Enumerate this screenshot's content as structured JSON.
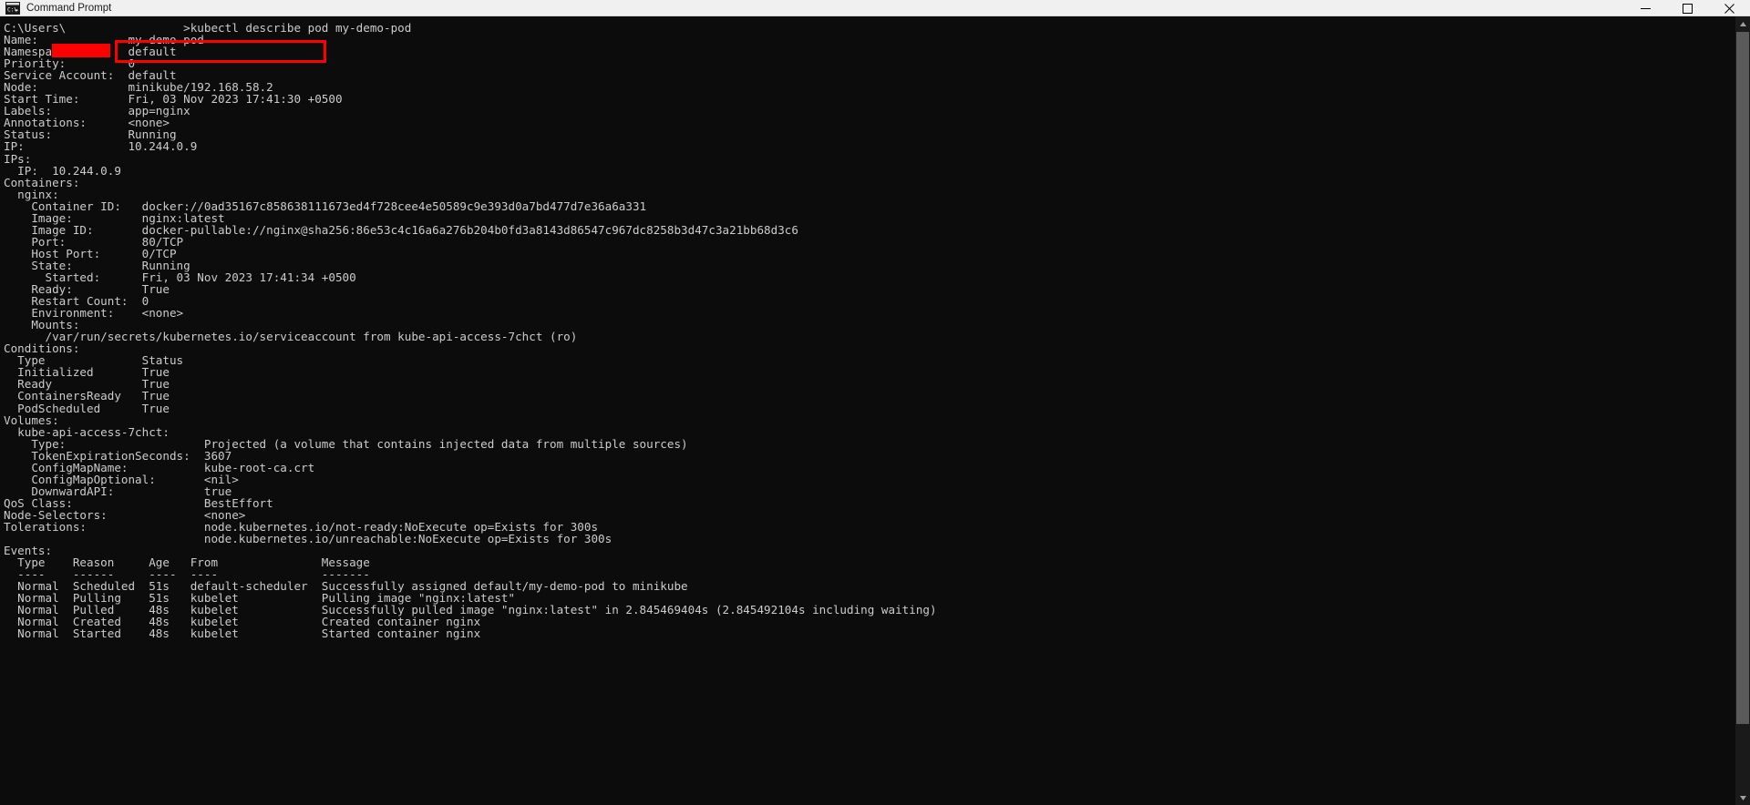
{
  "window": {
    "title": "Command Prompt",
    "icon": "console-icon",
    "controls": {
      "minimize": "minimize-icon",
      "maximize": "maximize-icon",
      "close": "close-icon"
    }
  },
  "annotations": {
    "redaction_color": "#ff0000",
    "highlight_color": "#ff0000",
    "redacted_username": true,
    "highlighted_command": "kubectl describe pod my-demo-pod"
  },
  "terminal": {
    "background": "#0c0c0c",
    "foreground": "#cccccc",
    "prompt_prefix": "C:\\Users\\",
    "prompt_suffix": ">",
    "command": "kubectl describe pod my-demo-pod",
    "lines": [
      "C:\\Users\\                 >kubectl describe pod my-demo-pod",
      "Name:             my-demo-pod",
      "Namespace:        default",
      "Priority:         0",
      "Service Account:  default",
      "Node:             minikube/192.168.58.2",
      "Start Time:       Fri, 03 Nov 2023 17:41:30 +0500",
      "Labels:           app=nginx",
      "Annotations:      <none>",
      "Status:           Running",
      "IP:               10.244.0.9",
      "IPs:",
      "  IP:  10.244.0.9",
      "Containers:",
      "  nginx:",
      "    Container ID:   docker://0ad35167c858638111673ed4f728cee4e50589c9e393d0a7bd477d7e36a6a331",
      "    Image:          nginx:latest",
      "    Image ID:       docker-pullable://nginx@sha256:86e53c4c16a6a276b204b0fd3a8143d86547c967dc8258b3d47c3a21bb68d3c6",
      "    Port:           80/TCP",
      "    Host Port:      0/TCP",
      "    State:          Running",
      "      Started:      Fri, 03 Nov 2023 17:41:34 +0500",
      "    Ready:          True",
      "    Restart Count:  0",
      "    Environment:    <none>",
      "    Mounts:",
      "      /var/run/secrets/kubernetes.io/serviceaccount from kube-api-access-7chct (ro)",
      "Conditions:",
      "  Type              Status",
      "  Initialized       True",
      "  Ready             True",
      "  ContainersReady   True",
      "  PodScheduled      True",
      "Volumes:",
      "  kube-api-access-7chct:",
      "    Type:                    Projected (a volume that contains injected data from multiple sources)",
      "    TokenExpirationSeconds:  3607",
      "    ConfigMapName:           kube-root-ca.crt",
      "    ConfigMapOptional:       <nil>",
      "    DownwardAPI:             true",
      "QoS Class:                   BestEffort",
      "Node-Selectors:              <none>",
      "Tolerations:                 node.kubernetes.io/not-ready:NoExecute op=Exists for 300s",
      "                             node.kubernetes.io/unreachable:NoExecute op=Exists for 300s",
      "Events:",
      "  Type    Reason     Age   From               Message",
      "  ----    ------     ----  ----               -------",
      "  Normal  Scheduled  51s   default-scheduler  Successfully assigned default/my-demo-pod to minikube",
      "  Normal  Pulling    51s   kubelet            Pulling image \"nginx:latest\"",
      "  Normal  Pulled     48s   kubelet            Successfully pulled image \"nginx:latest\" in 2.845469404s (2.845492104s including waiting)",
      "  Normal  Created    48s   kubelet            Created container nginx",
      "  Normal  Started    48s   kubelet            Started container nginx"
    ],
    "pod": {
      "name": "my-demo-pod",
      "namespace": "default",
      "priority": "0",
      "service_account": "default",
      "node": "minikube/192.168.58.2",
      "start_time": "Fri, 03 Nov 2023 17:41:30 +0500",
      "labels": "app=nginx",
      "annotations": "<none>",
      "status": "Running",
      "ip": "10.244.0.9",
      "qos_class": "BestEffort",
      "node_selectors": "<none>"
    },
    "container": {
      "name": "nginx",
      "container_id": "docker://0ad35167c858638111673ed4f728cee4e50589c9e393d0a7bd477d7e36a6a331",
      "image": "nginx:latest",
      "image_id": "docker-pullable://nginx@sha256:86e53c4c16a6a276b204b0fd3a8143d86547c967dc8258b3d47c3a21bb68d3c6",
      "port": "80/TCP",
      "host_port": "0/TCP",
      "state": "Running",
      "started": "Fri, 03 Nov 2023 17:41:34 +0500",
      "ready": "True",
      "restart_count": "0",
      "environment": "<none>",
      "mount": "/var/run/secrets/kubernetes.io/serviceaccount from kube-api-access-7chct (ro)"
    },
    "conditions": {
      "headers": [
        "Type",
        "Status"
      ],
      "rows": [
        [
          "Initialized",
          "True"
        ],
        [
          "Ready",
          "True"
        ],
        [
          "ContainersReady",
          "True"
        ],
        [
          "PodScheduled",
          "True"
        ]
      ]
    },
    "volumes": {
      "name": "kube-api-access-7chct",
      "type": "Projected (a volume that contains injected data from multiple sources)",
      "token_expiration_seconds": "3607",
      "config_map_name": "kube-root-ca.crt",
      "config_map_optional": "<nil>",
      "downward_api": "true"
    },
    "tolerations": [
      "node.kubernetes.io/not-ready:NoExecute op=Exists for 300s",
      "node.kubernetes.io/unreachable:NoExecute op=Exists for 300s"
    ],
    "events": {
      "headers": [
        "Type",
        "Reason",
        "Age",
        "From",
        "Message"
      ],
      "rows": [
        [
          "Normal",
          "Scheduled",
          "51s",
          "default-scheduler",
          "Successfully assigned default/my-demo-pod to minikube"
        ],
        [
          "Normal",
          "Pulling",
          "51s",
          "kubelet",
          "Pulling image \"nginx:latest\""
        ],
        [
          "Normal",
          "Pulled",
          "48s",
          "kubelet",
          "Successfully pulled image \"nginx:latest\" in 2.845469404s (2.845492104s including waiting)"
        ],
        [
          "Normal",
          "Created",
          "48s",
          "kubelet",
          "Created container nginx"
        ],
        [
          "Normal",
          "Started",
          "48s",
          "kubelet",
          "Started container nginx"
        ]
      ]
    }
  }
}
